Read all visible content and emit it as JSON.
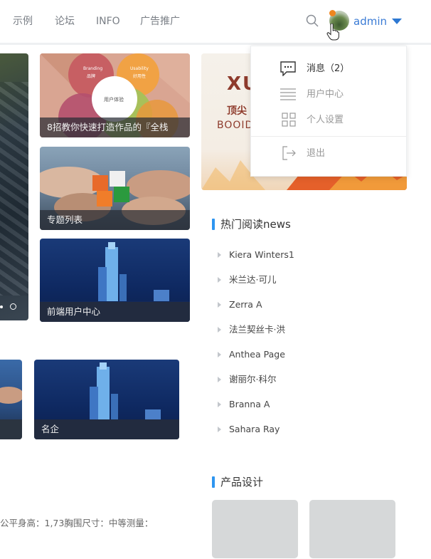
{
  "nav": {
    "items": [
      "示例",
      "论坛",
      "INFO",
      "广告推广"
    ],
    "user": "admin"
  },
  "cards": {
    "col1": [
      {
        "caption": "8招教你快速打造作品的『全栈"
      },
      {
        "caption": "专题列表"
      },
      {
        "caption": "前端用户中心"
      }
    ],
    "row2": [
      {
        "caption": "名企"
      }
    ],
    "venn": {
      "branding": "Branding",
      "branding_cn": "品牌",
      "usability": "Usability",
      "usability_cn": "好用性",
      "center": "用户体验"
    },
    "banner": {
      "big": "XU",
      "line1": "顶尖",
      "line2": "BOOID"
    }
  },
  "dropdown": {
    "items": [
      {
        "label": "消息（2）",
        "icon": "message-icon"
      },
      {
        "label": "用户中心",
        "icon": "list-icon"
      },
      {
        "label": "个人设置",
        "icon": "grid-icon"
      },
      {
        "label": "退出",
        "icon": "logout-icon"
      }
    ]
  },
  "hot_news": {
    "title": "热门阅读news",
    "items": [
      "Kiera Winters1",
      "米兰达·可儿",
      "Zerra A",
      "法兰契丝卡·洪",
      "Anthea Page",
      "谢丽尔·科尔",
      "Branna A",
      "Sahara Ray"
    ]
  },
  "product": {
    "title": "产品设计"
  },
  "bottom_text": "公平身高：1,73胸围尺寸：中等测量：",
  "colors": {
    "accent": "#2e95f0",
    "admin": "#3a7bd5",
    "badge": "#f0861f"
  }
}
